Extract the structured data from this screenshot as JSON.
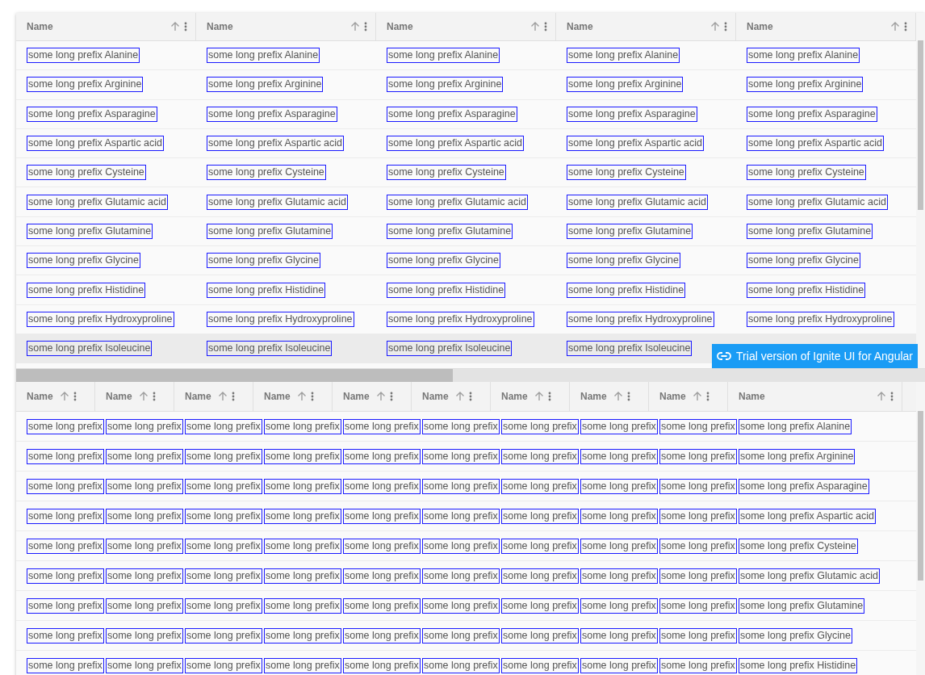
{
  "grids": [
    {
      "columns": [
        {
          "label": "Name"
        },
        {
          "label": "Name"
        },
        {
          "label": "Name"
        },
        {
          "label": "Name"
        },
        {
          "label": "Name"
        }
      ],
      "rows": [
        {
          "selected": false,
          "cells": [
            "some long prefix Alanine",
            "some long prefix Alanine",
            "some long prefix Alanine",
            "some long prefix Alanine",
            "some long prefix Alanine"
          ]
        },
        {
          "selected": false,
          "cells": [
            "some long prefix Arginine",
            "some long prefix Arginine",
            "some long prefix Arginine",
            "some long prefix Arginine",
            "some long prefix Arginine"
          ]
        },
        {
          "selected": false,
          "cells": [
            "some long prefix Asparagine",
            "some long prefix Asparagine",
            "some long prefix Asparagine",
            "some long prefix Asparagine",
            "some long prefix Asparagine"
          ]
        },
        {
          "selected": false,
          "cells": [
            "some long prefix Aspartic acid",
            "some long prefix Aspartic acid",
            "some long prefix Aspartic acid",
            "some long prefix Aspartic acid",
            "some long prefix Aspartic acid"
          ]
        },
        {
          "selected": false,
          "cells": [
            "some long prefix Cysteine",
            "some long prefix Cysteine",
            "some long prefix Cysteine",
            "some long prefix Cysteine",
            "some long prefix Cysteine"
          ]
        },
        {
          "selected": false,
          "cells": [
            "some long prefix Glutamic acid",
            "some long prefix Glutamic acid",
            "some long prefix Glutamic acid",
            "some long prefix Glutamic acid",
            "some long prefix Glutamic acid"
          ]
        },
        {
          "selected": false,
          "cells": [
            "some long prefix Glutamine",
            "some long prefix Glutamine",
            "some long prefix Glutamine",
            "some long prefix Glutamine",
            "some long prefix Glutamine"
          ]
        },
        {
          "selected": false,
          "cells": [
            "some long prefix Glycine",
            "some long prefix Glycine",
            "some long prefix Glycine",
            "some long prefix Glycine",
            "some long prefix Glycine"
          ]
        },
        {
          "selected": false,
          "cells": [
            "some long prefix Histidine",
            "some long prefix Histidine",
            "some long prefix Histidine",
            "some long prefix Histidine",
            "some long prefix Histidine"
          ]
        },
        {
          "selected": false,
          "cells": [
            "some long prefix Hydroxyproline",
            "some long prefix Hydroxyproline",
            "some long prefix Hydroxyproline",
            "some long prefix Hydroxyproline",
            "some long prefix Hydroxyproline"
          ]
        },
        {
          "selected": true,
          "cells": [
            "some long prefix Isoleucine",
            "some long prefix Isoleucine",
            "some long prefix Isoleucine",
            "some long prefix Isoleucine"
          ]
        }
      ],
      "badge": {
        "label": "Trial version of Ignite UI for Angular"
      }
    },
    {
      "columns": [
        {
          "label": "Name"
        },
        {
          "label": "Name"
        },
        {
          "label": "Name"
        },
        {
          "label": "Name"
        },
        {
          "label": "Name"
        },
        {
          "label": "Name"
        },
        {
          "label": "Name"
        },
        {
          "label": "Name"
        },
        {
          "label": "Name"
        },
        {
          "label": "Name"
        }
      ],
      "rows": [
        {
          "selected": false,
          "cells": [
            "some long prefix",
            "some long prefix",
            "some long prefix",
            "some long prefix",
            "some long prefix",
            "some long prefix",
            "some long prefix",
            "some long prefix",
            "some long prefix",
            "some long prefix Alanine"
          ]
        },
        {
          "selected": false,
          "cells": [
            "some long prefix",
            "some long prefix",
            "some long prefix",
            "some long prefix",
            "some long prefix",
            "some long prefix",
            "some long prefix",
            "some long prefix",
            "some long prefix",
            "some long prefix Arginine"
          ]
        },
        {
          "selected": false,
          "cells": [
            "some long prefix",
            "some long prefix",
            "some long prefix",
            "some long prefix",
            "some long prefix",
            "some long prefix",
            "some long prefix",
            "some long prefix",
            "some long prefix",
            "some long prefix Asparagine"
          ]
        },
        {
          "selected": false,
          "cells": [
            "some long prefix",
            "some long prefix",
            "some long prefix",
            "some long prefix",
            "some long prefix",
            "some long prefix",
            "some long prefix",
            "some long prefix",
            "some long prefix",
            "some long prefix Aspartic acid"
          ]
        },
        {
          "selected": false,
          "cells": [
            "some long prefix",
            "some long prefix",
            "some long prefix",
            "some long prefix",
            "some long prefix",
            "some long prefix",
            "some long prefix",
            "some long prefix",
            "some long prefix",
            "some long prefix Cysteine"
          ]
        },
        {
          "selected": false,
          "cells": [
            "some long prefix",
            "some long prefix",
            "some long prefix",
            "some long prefix",
            "some long prefix",
            "some long prefix",
            "some long prefix",
            "some long prefix",
            "some long prefix",
            "some long prefix Glutamic acid"
          ]
        },
        {
          "selected": false,
          "cells": [
            "some long prefix",
            "some long prefix",
            "some long prefix",
            "some long prefix",
            "some long prefix",
            "some long prefix",
            "some long prefix",
            "some long prefix",
            "some long prefix",
            "some long prefix Glutamine"
          ]
        },
        {
          "selected": false,
          "cells": [
            "some long prefix",
            "some long prefix",
            "some long prefix",
            "some long prefix",
            "some long prefix",
            "some long prefix",
            "some long prefix",
            "some long prefix",
            "some long prefix",
            "some long prefix Glycine"
          ]
        },
        {
          "selected": false,
          "cells": [
            "some long prefix",
            "some long prefix",
            "some long prefix",
            "some long prefix",
            "some long prefix",
            "some long prefix",
            "some long prefix",
            "some long prefix",
            "some long prefix",
            "some long prefix Histidine"
          ]
        }
      ]
    }
  ]
}
